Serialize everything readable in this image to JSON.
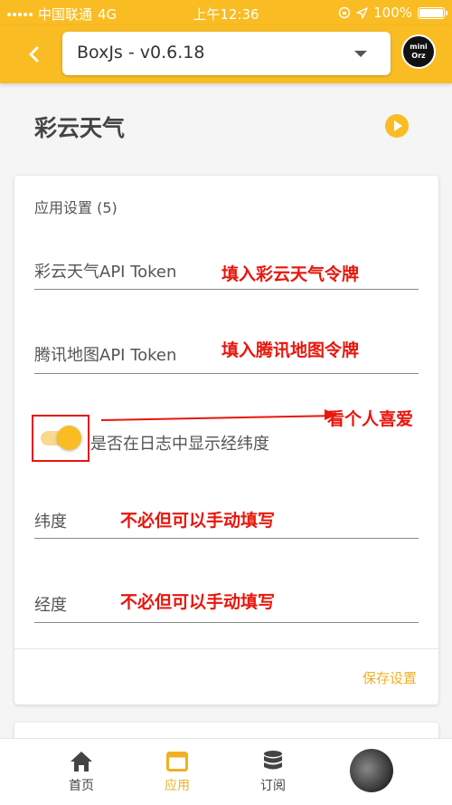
{
  "status_bar": {
    "carrier": "中国联通",
    "network": "4G",
    "time": "上午12:36",
    "battery": "100%"
  },
  "app_bar": {
    "back_icon": "chevron-left-icon",
    "selector_value": "BoxJs - v0.6.18",
    "avatar_text_line1": "mini",
    "avatar_text_line2": "Orz"
  },
  "page": {
    "title": "彩云天气",
    "run_icon": "play-icon"
  },
  "settings_card": {
    "title": "应用设置 (5)",
    "fields": [
      {
        "label": "彩云天气API Token",
        "annotation": "填入彩云天气令牌"
      },
      {
        "label": "腾讯地图API Token",
        "annotation": "填入腾讯地图令牌"
      }
    ],
    "toggle": {
      "label": "是否在日志中显示经纬度",
      "checked": true,
      "annotation": "看个人喜爱"
    },
    "coords": [
      {
        "label": "纬度",
        "annotation": "不必但可以手动填写"
      },
      {
        "label": "经度",
        "annotation": "不必但可以手动填写"
      }
    ],
    "save_label": "保存设置"
  },
  "bottom_nav": {
    "items": [
      {
        "label": "首页",
        "icon": "home-icon"
      },
      {
        "label": "应用",
        "icon": "window-icon"
      },
      {
        "label": "订阅",
        "icon": "database-icon"
      }
    ],
    "active_index": 1
  },
  "colors": {
    "accent": "#f9bc23",
    "annotation": "#e8160c"
  }
}
